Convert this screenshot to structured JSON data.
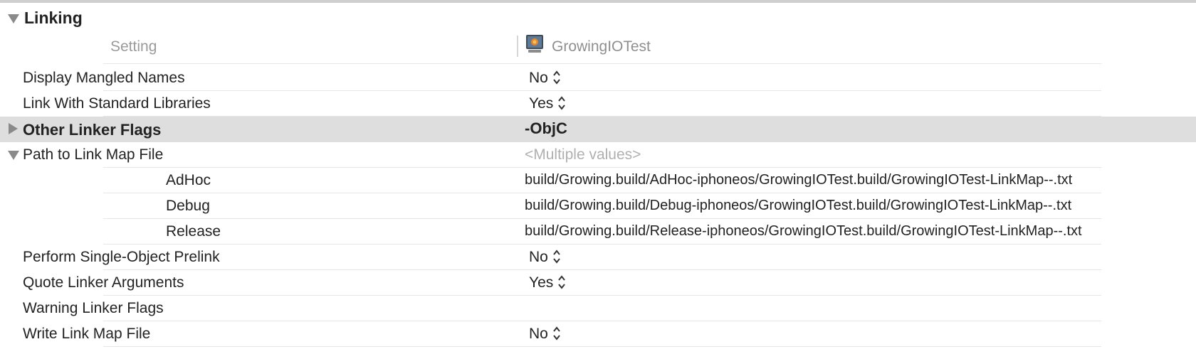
{
  "section": {
    "title": "Linking"
  },
  "columns": {
    "setting": "Setting",
    "target": "GrowingIOTest"
  },
  "rows": [
    {
      "name": "Display Mangled Names",
      "value": "No"
    },
    {
      "name": "Link With Standard Libraries",
      "value": "Yes"
    },
    {
      "name": "Other Linker Flags",
      "value": "-ObjC"
    },
    {
      "name": "Path to Link Map File",
      "value": "<Multiple values>"
    },
    {
      "name": "AdHoc",
      "value": "build/Growing.build/AdHoc-iphoneos/GrowingIOTest.build/GrowingIOTest-LinkMap--.txt"
    },
    {
      "name": "Debug",
      "value": "build/Growing.build/Debug-iphoneos/GrowingIOTest.build/GrowingIOTest-LinkMap--.txt"
    },
    {
      "name": "Release",
      "value": "build/Growing.build/Release-iphoneos/GrowingIOTest.build/GrowingIOTest-LinkMap--.txt"
    },
    {
      "name": "Perform Single-Object Prelink",
      "value": "No"
    },
    {
      "name": "Quote Linker Arguments",
      "value": "Yes"
    },
    {
      "name": "Warning Linker Flags",
      "value": ""
    },
    {
      "name": "Write Link Map File",
      "value": "No"
    }
  ],
  "colors": {
    "highlight": "#dedede",
    "separator": "#e6e6e6",
    "muted": "#b0b0b0"
  }
}
